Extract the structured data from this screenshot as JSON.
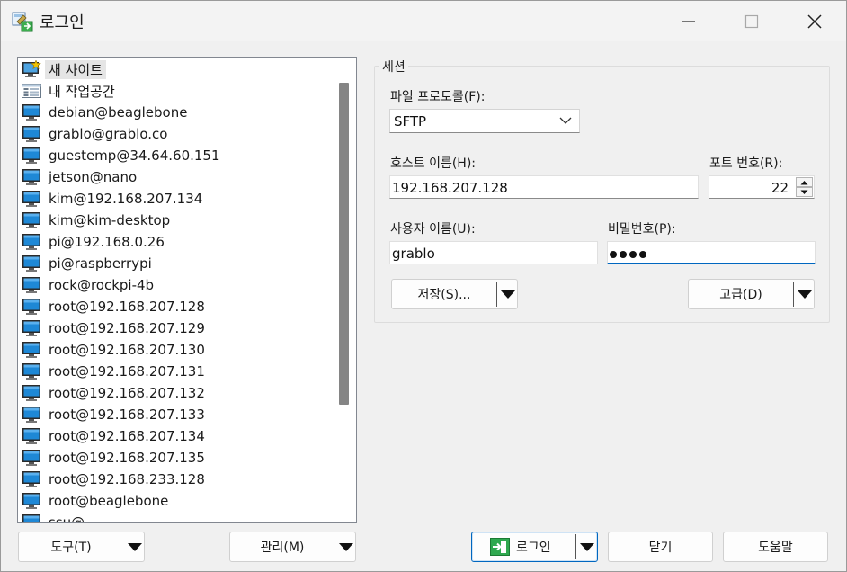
{
  "window": {
    "title": "로그인"
  },
  "sites": {
    "items": [
      {
        "label": "새 사이트",
        "icon": "new-site-icon",
        "selected": true
      },
      {
        "label": "내 작업공간",
        "icon": "workspace-icon"
      },
      {
        "label": "debian@beaglebone",
        "icon": "computer-icon"
      },
      {
        "label": "grablo@grablo.co",
        "icon": "computer-icon"
      },
      {
        "label": "guestemp@34.64.60.151",
        "icon": "computer-icon"
      },
      {
        "label": "jetson@nano",
        "icon": "computer-icon"
      },
      {
        "label": "kim@192.168.207.134",
        "icon": "computer-icon"
      },
      {
        "label": "kim@kim-desktop",
        "icon": "computer-icon"
      },
      {
        "label": "pi@192.168.0.26",
        "icon": "computer-icon"
      },
      {
        "label": "pi@raspberrypi",
        "icon": "computer-icon"
      },
      {
        "label": "rock@rockpi-4b",
        "icon": "computer-icon"
      },
      {
        "label": "root@192.168.207.128",
        "icon": "computer-icon"
      },
      {
        "label": "root@192.168.207.129",
        "icon": "computer-icon"
      },
      {
        "label": "root@192.168.207.130",
        "icon": "computer-icon"
      },
      {
        "label": "root@192.168.207.131",
        "icon": "computer-icon"
      },
      {
        "label": "root@192.168.207.132",
        "icon": "computer-icon"
      },
      {
        "label": "root@192.168.207.133",
        "icon": "computer-icon"
      },
      {
        "label": "root@192.168.207.134",
        "icon": "computer-icon"
      },
      {
        "label": "root@192.168.207.135",
        "icon": "computer-icon"
      },
      {
        "label": "root@192.168.233.128",
        "icon": "computer-icon"
      },
      {
        "label": "root@beaglebone",
        "icon": "computer-icon"
      },
      {
        "label": "ssu@...",
        "icon": "computer-icon"
      }
    ]
  },
  "session": {
    "group_label": "세션",
    "protocol_label": "파일 프로토콜(F):",
    "protocol_value": "SFTP",
    "host_label": "호스트 이름(H):",
    "host_value": "192.168.207.128",
    "port_label": "포트 번호(R):",
    "port_value": "22",
    "user_label": "사용자 이름(U):",
    "user_value": "grablo",
    "password_label": "비밀번호(P):",
    "password_dots": 4,
    "save_label": "저장(S)...",
    "advanced_label": "고급(D)"
  },
  "footer": {
    "tools_label": "도구(T)",
    "manage_label": "관리(M)",
    "login_label": "로그인",
    "close_label": "닫기",
    "help_label": "도움말"
  },
  "colors": {
    "accent": "#0067c0",
    "monitor_screen": "#1e88d6",
    "login_icon": "#2fa84f"
  }
}
